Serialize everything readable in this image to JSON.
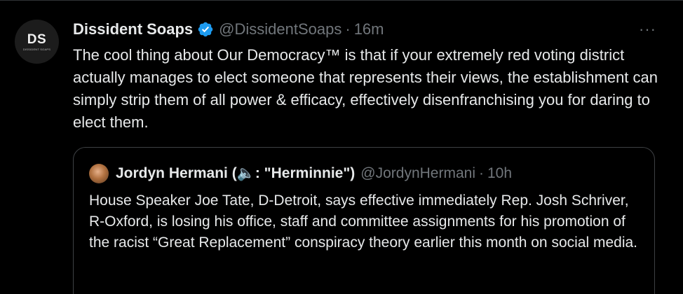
{
  "tweet": {
    "avatar_monogram": "DS",
    "avatar_subtext": "DISSIDENT SOAPS",
    "display_name": "Dissident Soaps",
    "verified_icon": "verified-badge-icon",
    "handle": "@DissidentSoaps",
    "separator": "·",
    "time": "16m",
    "more_icon": "more-options-icon",
    "more_label": "···",
    "text": "The cool thing about Our Democracy™  is that if your extremely red voting district actually manages to elect someone that represents their views, the establishment can simply strip them of all power & efficacy, effectively disenfranchising you for daring to elect them."
  },
  "quote": {
    "avatar_icon": "profile-photo",
    "display_name": "Jordyn Hermani (🔈: \"Herminnie\")",
    "handle": "@JordynHermani",
    "separator": "·",
    "time": "10h",
    "text": "House Speaker Joe Tate, D-Detroit, says effective immediately Rep. Josh Schriver, R-Oxford, is losing his office, staff and committee assignments for his promotion of the racist “Great Replacement” conspiracy theory earlier this month on social media."
  },
  "colors": {
    "background": "#000000",
    "text_primary": "#e7e9ea",
    "text_secondary": "#71767b",
    "verified_blue": "#1d9bf0",
    "quote_border": "#3e4144"
  }
}
